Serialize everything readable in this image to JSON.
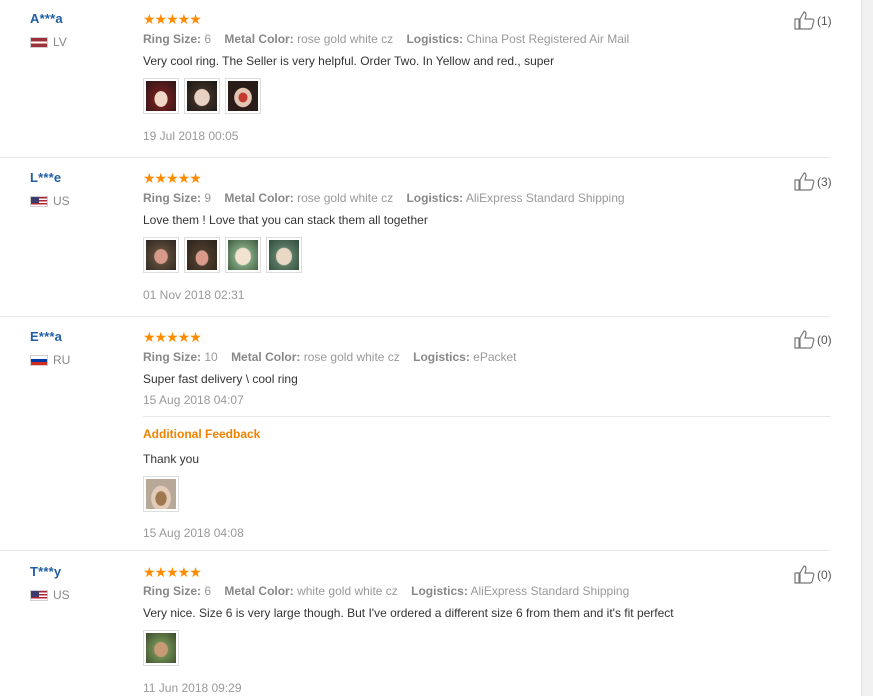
{
  "labels": {
    "ring_size": "Ring Size:",
    "metal_color": "Metal Color:",
    "logistics": "Logistics:",
    "additional_feedback": "Additional Feedback"
  },
  "stars": "★★★★★",
  "reviews": [
    {
      "user": "A***a",
      "country": "LV",
      "ring_size": "6",
      "metal_color": "rose gold white cz",
      "logistics": "China Post Registered Air Mail",
      "text": "Very cool ring. The Seller is very helpful. Order Two. In Yellow and red., super",
      "date": "19 Jul 2018 00:05",
      "helpful": "(1)"
    },
    {
      "user": "L***e",
      "country": "US",
      "ring_size": "9",
      "metal_color": "rose gold white cz",
      "logistics": "AliExpress Standard Shipping",
      "text": "Love them ! Love that you can stack them all together",
      "date": "01 Nov 2018 02:31",
      "helpful": "(3)"
    },
    {
      "user": "E***a",
      "country": "RU",
      "ring_size": "10",
      "metal_color": "rose gold white cz",
      "logistics": "ePacket",
      "text": "Super fast delivery \\ cool ring",
      "date": "15 Aug 2018 04:07",
      "helpful": "(0)",
      "additional_text": "Thank you",
      "additional_date": "15 Aug 2018 04:08"
    },
    {
      "user": "T***y",
      "country": "US",
      "ring_size": "6",
      "metal_color": "white gold white cz",
      "logistics": "AliExpress Standard Shipping",
      "text": "Very nice. Size 6 is very large though. But I've ordered a different size 6 from them and it's fit perfect",
      "date": "11 Jun 2018 09:29",
      "helpful": "(0)"
    }
  ],
  "colors": {
    "username": "#1f5ea3",
    "star": "#ff8c00",
    "additional_feedback": "#f08200"
  }
}
